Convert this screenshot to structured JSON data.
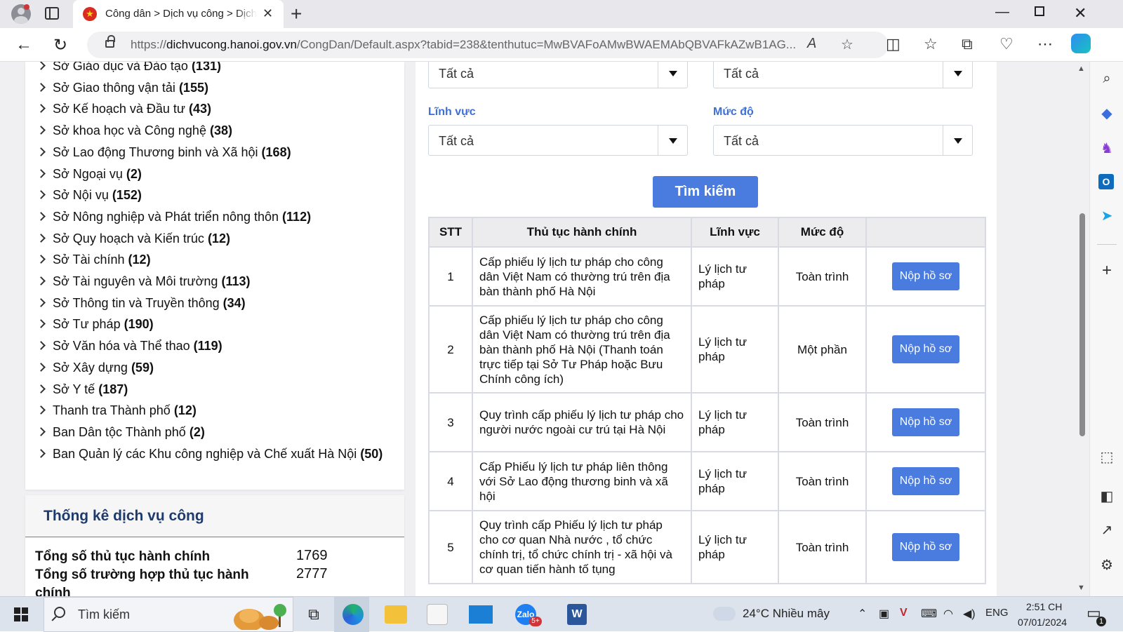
{
  "browser": {
    "tab_title": "Công dân > Dịch vụ công > Dịch vụ công",
    "url_prefix": "https://",
    "url_host": "dichvucong.hanoi.gov.vn",
    "url_path": "/CongDan/Default.aspx?tabid=238&tenthutuc=MwBVAFoAMwBWAEMAbQBVAFkAZwB1AG..."
  },
  "agencies": [
    {
      "name": "Sở Giáo dục và Đào tạo",
      "count": "(131)"
    },
    {
      "name": "Sở Giao thông vận tải",
      "count": "(155)"
    },
    {
      "name": "Sở Kế hoạch và Đầu tư",
      "count": "(43)"
    },
    {
      "name": "Sở khoa học và Công nghệ",
      "count": "(38)"
    },
    {
      "name": "Sở Lao động Thương binh và Xã hội",
      "count": "(168)"
    },
    {
      "name": "Sở Ngoại vụ",
      "count": "(2)"
    },
    {
      "name": "Sở Nội vụ",
      "count": "(152)"
    },
    {
      "name": "Sở Nông nghiệp và Phát triển nông thôn",
      "count": "(112)"
    },
    {
      "name": "Sở Quy hoạch và Kiến trúc",
      "count": "(12)"
    },
    {
      "name": "Sở Tài chính",
      "count": "(12)"
    },
    {
      "name": "Sở Tài nguyên và Môi trường",
      "count": "(113)"
    },
    {
      "name": "Sở Thông tin và Truyền thông",
      "count": "(34)"
    },
    {
      "name": "Sở Tư pháp",
      "count": "(190)"
    },
    {
      "name": "Sở Văn hóa và Thể thao",
      "count": "(119)"
    },
    {
      "name": "Sở Xây dựng",
      "count": "(59)"
    },
    {
      "name": "Sở Y tế",
      "count": "(187)"
    },
    {
      "name": "Thanh tra Thành phố",
      "count": "(12)"
    },
    {
      "name": "Ban Dân tộc Thành phố",
      "count": "(2)"
    },
    {
      "name": "Ban Quản lý các Khu công nghiệp và Chế xuất Hà Nội",
      "count": "(50)"
    }
  ],
  "stats": {
    "title": "Thống kê dịch vụ công",
    "rows": [
      {
        "label": "Tổng số thủ tục hành chính",
        "value": "1769"
      },
      {
        "label": "Tổng số trường hợp thủ tục hành chính",
        "value": "2777"
      }
    ]
  },
  "filters": {
    "select_top_left": "Tất cả",
    "select_top_right": "Tất cả",
    "field_label": "Lĩnh vực",
    "field_value": "Tất cả",
    "level_label": "Mức độ",
    "level_value": "Tất cả",
    "search_button": "Tìm kiếm"
  },
  "table": {
    "headers": [
      "STT",
      "Thủ tục hành chính",
      "Lĩnh vực",
      "Mức độ",
      ""
    ],
    "rows": [
      {
        "stt": "1",
        "name": "Cấp phiếu lý lịch tư pháp cho công dân Việt Nam có thường trú trên địa bàn thành phố Hà Nội",
        "field": "Lý lịch tư pháp",
        "level": "Toàn trình",
        "action": "Nộp hồ sơ"
      },
      {
        "stt": "2",
        "name": "Cấp phiếu lý lịch tư pháp cho công dân Việt Nam có thường trú trên địa bàn thành phố Hà Nội (Thanh toán trực tiếp tại Sở Tư Pháp hoặc Bưu Chính công ích)",
        "field": "Lý lịch tư pháp",
        "level": "Một phần",
        "action": "Nộp hồ sơ"
      },
      {
        "stt": "3",
        "name": "Quy trình cấp phiếu lý lịch tư pháp cho người nước ngoài cư trú tại Hà Nội",
        "field": "Lý lịch tư pháp",
        "level": "Toàn trình",
        "action": "Nộp hồ sơ"
      },
      {
        "stt": "4",
        "name": "Cấp Phiếu lý lịch tư pháp liên thông với Sở Lao động thương binh và xã hội",
        "field": "Lý lịch tư pháp",
        "level": "Toàn trình",
        "action": "Nộp hồ sơ"
      },
      {
        "stt": "5",
        "name": "Quy trình cấp Phiếu lý lịch tư pháp cho cơ quan Nhà nước , tổ chức chính trị, tổ chức chính trị - xã hội và cơ quan tiến hành tố tụng",
        "field": "Lý lịch tư pháp",
        "level": "Toàn trình",
        "action": "Nộp hồ sơ"
      }
    ]
  },
  "taskbar": {
    "search_placeholder": "Tìm kiếm",
    "weather": "24°C  Nhiều mây",
    "language": "ENG",
    "time": "2:51 CH",
    "date": "07/01/2024",
    "zalo_badge": "5+",
    "notification_count": "1"
  }
}
